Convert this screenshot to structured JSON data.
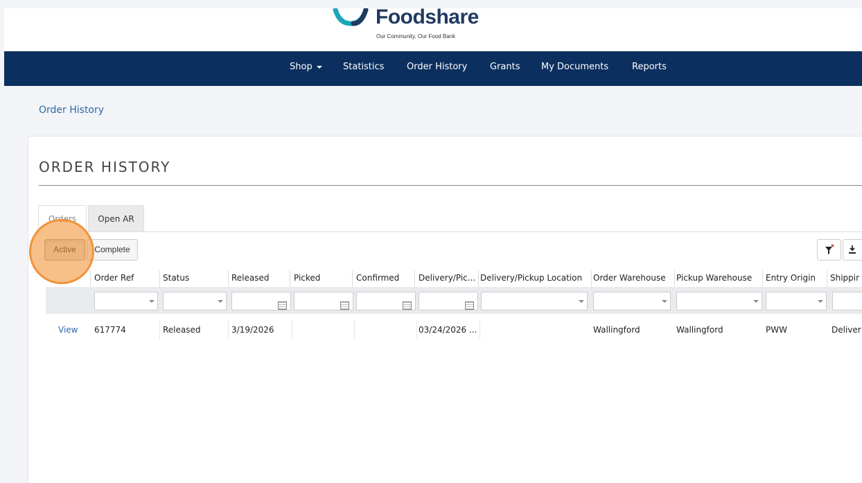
{
  "brand": {
    "name": "Foodshare",
    "tagline": "Our Community, Our Food Bank",
    "colors": {
      "navy": "#0b2f5e",
      "teal": "#1aa6b7",
      "link": "#2a6aa8",
      "highlight": "#f0933a"
    }
  },
  "nav": {
    "items": [
      {
        "label": "Shop",
        "has_caret": true
      },
      {
        "label": "Statistics"
      },
      {
        "label": "Order History"
      },
      {
        "label": "Grants"
      },
      {
        "label": "My Documents"
      },
      {
        "label": "Reports"
      }
    ]
  },
  "breadcrumb": "Order History",
  "page_title": "ORDER HISTORY",
  "tabs": [
    {
      "label": "Orders",
      "selected": true
    },
    {
      "label": "Open AR",
      "selected": false
    }
  ],
  "filters": {
    "active_label": "Active",
    "complete_label": "Complete"
  },
  "toolbar": {
    "clear_filter_icon": "filter-clear-icon",
    "export_icon": "download-icon"
  },
  "grid": {
    "columns": [
      "Order Ref",
      "Status",
      "Released",
      "Picked",
      "Confirmed",
      "Delivery/Pic...",
      "Delivery/Pickup Location",
      "Order Warehouse",
      "Pickup Warehouse",
      "Entry Origin",
      "Shippir"
    ],
    "rows": [
      {
        "action": "View",
        "order_ref": "617774",
        "status": "Released",
        "released": "3/19/2026",
        "picked": "",
        "confirmed": "",
        "delivery_pickup_date": "03/24/2026 ...",
        "delivery_pickup_location": "",
        "order_warehouse": "Wallingford",
        "pickup_warehouse": "Wallingford",
        "entry_origin": "PWW",
        "shipping": "Deliver"
      }
    ]
  }
}
